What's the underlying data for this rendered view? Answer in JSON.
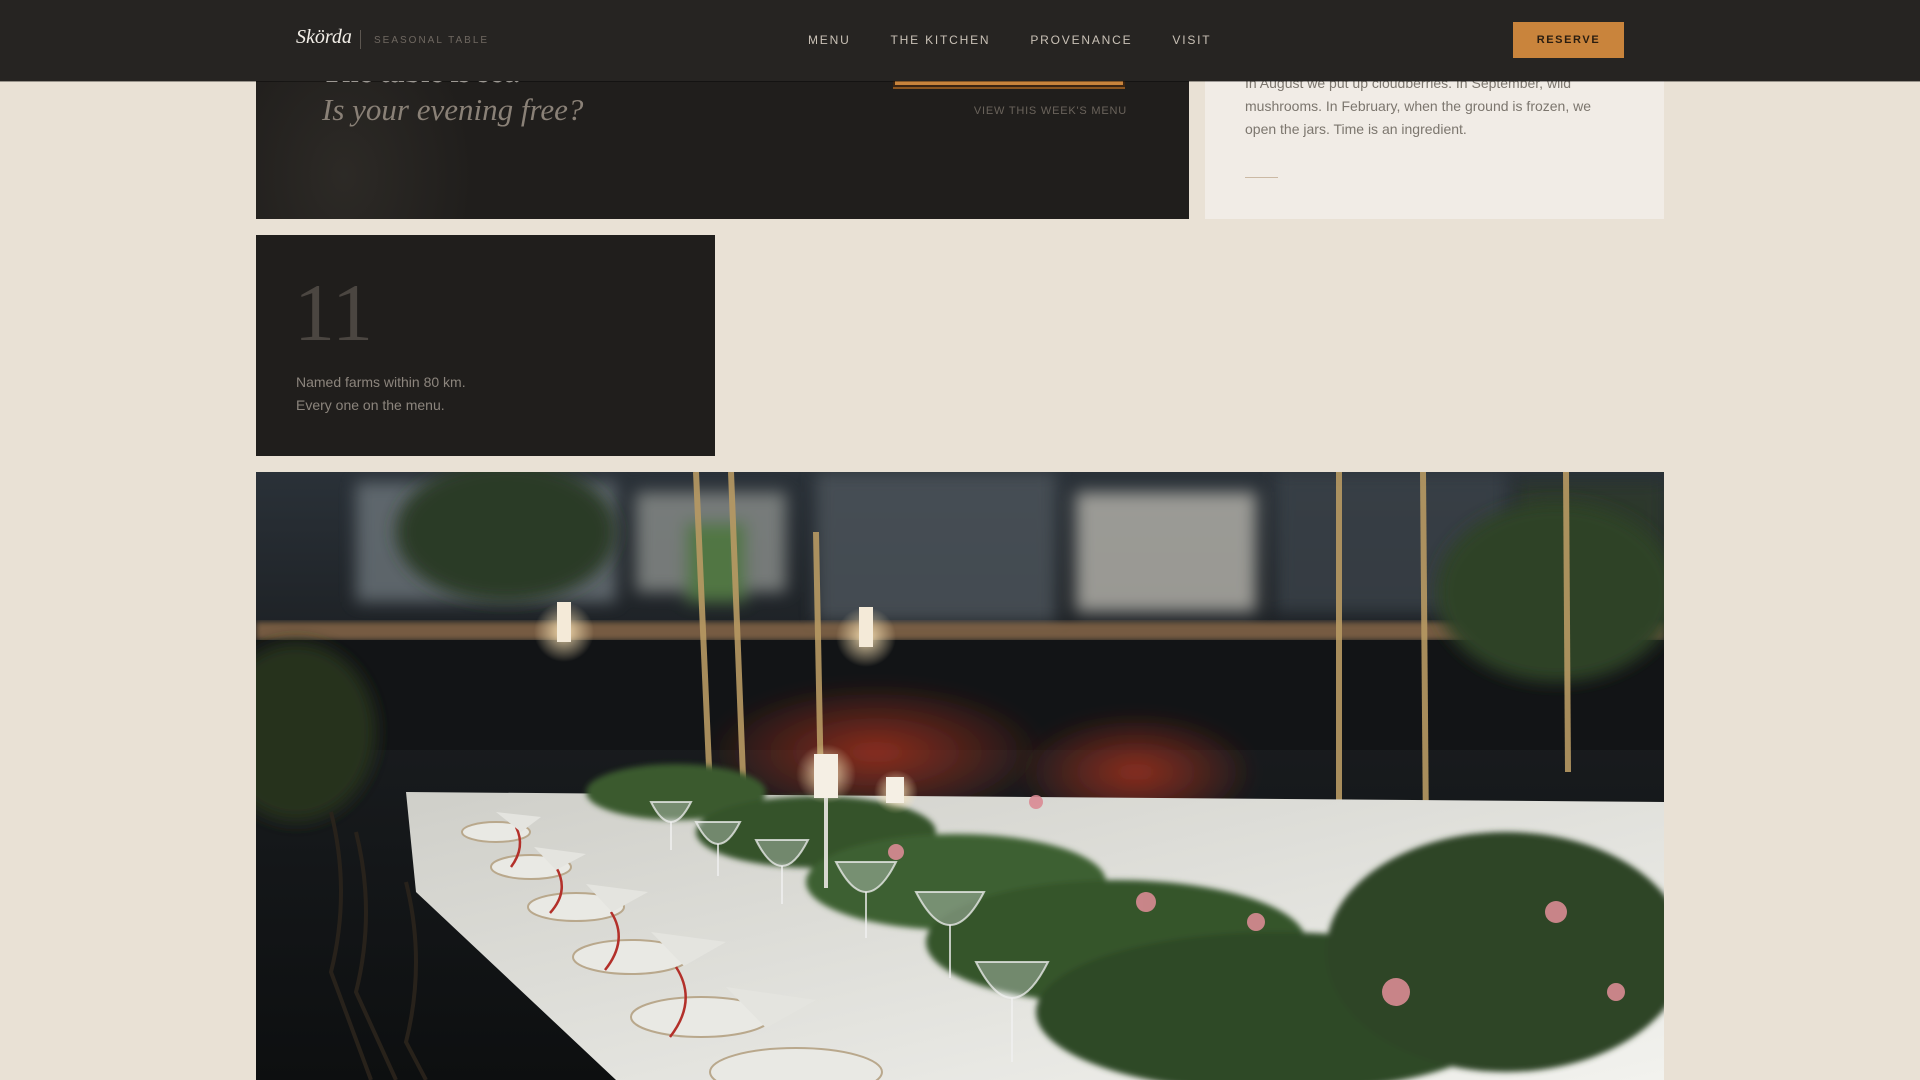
{
  "header": {
    "brand": "Skörda",
    "tagline": "SEASONAL TABLE",
    "nav": [
      "MENU",
      "THE KITCHEN",
      "PROVENANCE",
      "VISIT"
    ],
    "reserve_label": "RESERVE"
  },
  "cta": {
    "heading": "The table is set.",
    "subheading": "Is your evening free?",
    "menu_link": "VIEW THIS WEEK'S MENU"
  },
  "story": {
    "text": "In August we put up cloudberries. In September, wild mushrooms. In February, when the ground is frozen, we open the jars. Time is an ingredient."
  },
  "stat": {
    "number": "11",
    "line1": "Named farms within 80 km.",
    "line2": "Every one on the menu."
  },
  "colors": {
    "accent": "#c9843c",
    "page_bg": "#e9e1d5",
    "dark_card": "#201e1c",
    "header_bg": "#262422"
  },
  "photo": {
    "subject": "banquet-table-photo"
  }
}
